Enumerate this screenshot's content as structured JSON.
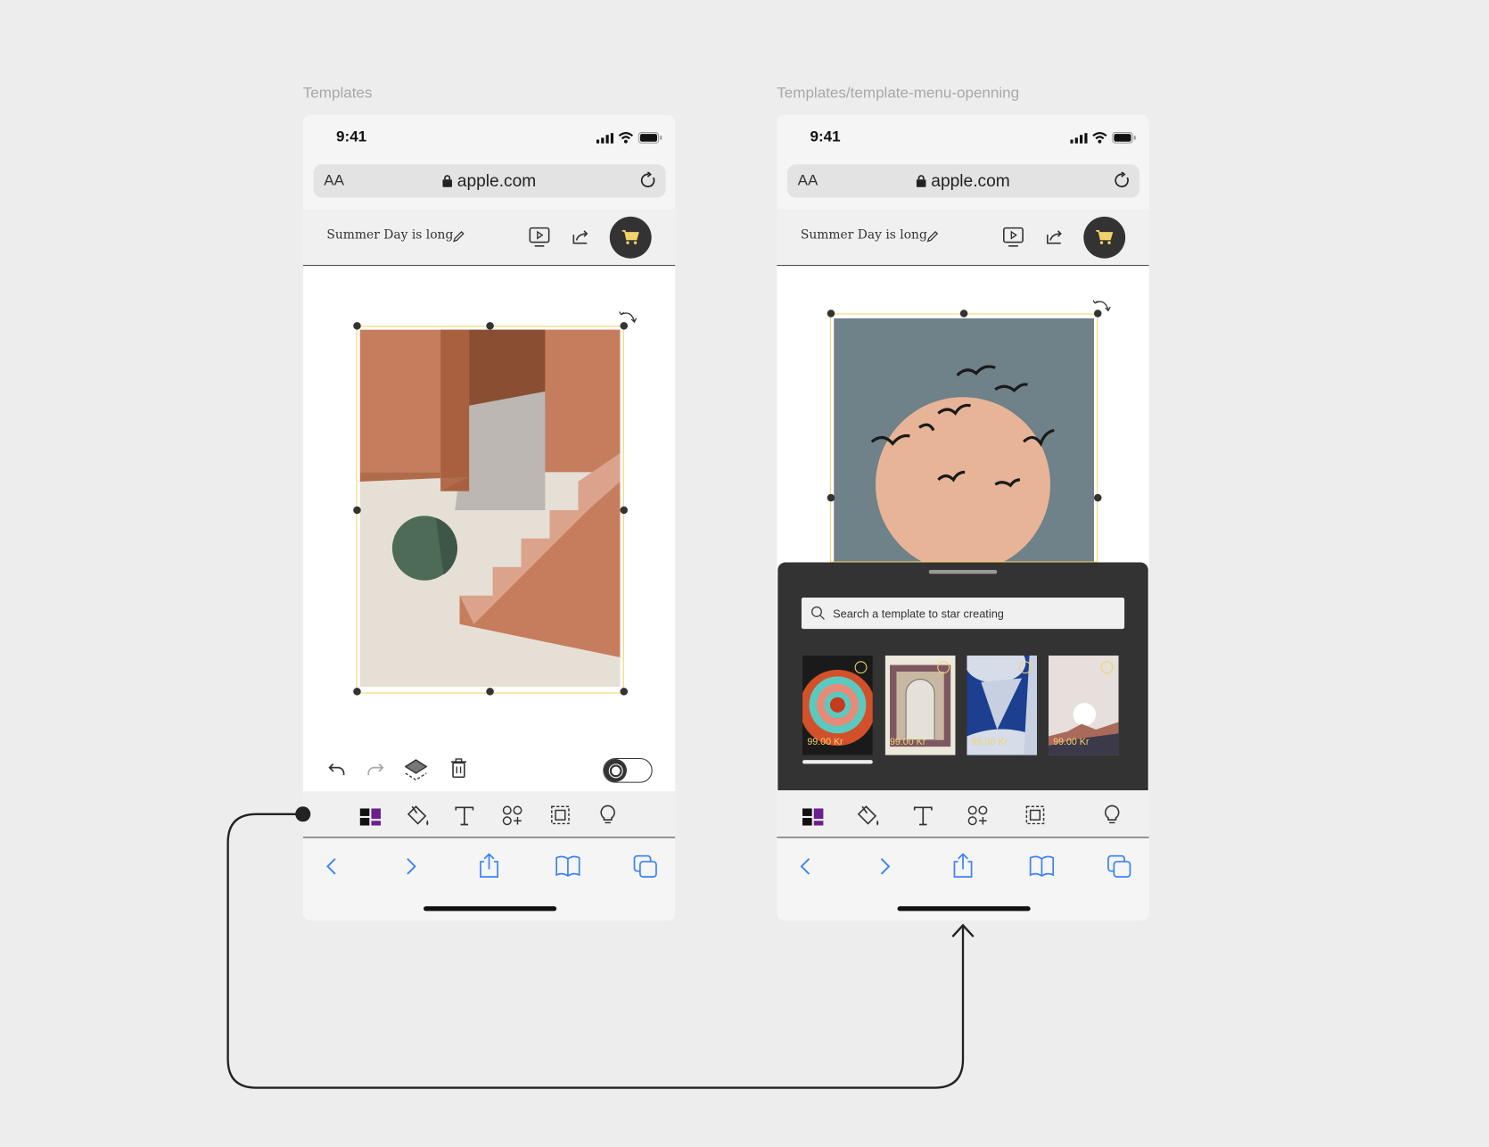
{
  "frames": [
    {
      "label": "Templates"
    },
    {
      "label": "Templates/template-menu-openning"
    }
  ],
  "status_bar": {
    "time": "9:41"
  },
  "browser": {
    "text_size": "AA",
    "address": "apple.com"
  },
  "editor": {
    "document_title": "Summer Day is long"
  },
  "template_menu": {
    "search_placeholder": "Search a template to star creating",
    "templates": [
      {
        "price": "99.00 Kr"
      },
      {
        "price": "99.00 Kr"
      },
      {
        "price": "99.00 Kr"
      },
      {
        "price": "99.00 Kr"
      }
    ]
  },
  "colors": {
    "accent": "#f2d36b",
    "dark": "#333333",
    "link_blue": "#3b82f6"
  }
}
